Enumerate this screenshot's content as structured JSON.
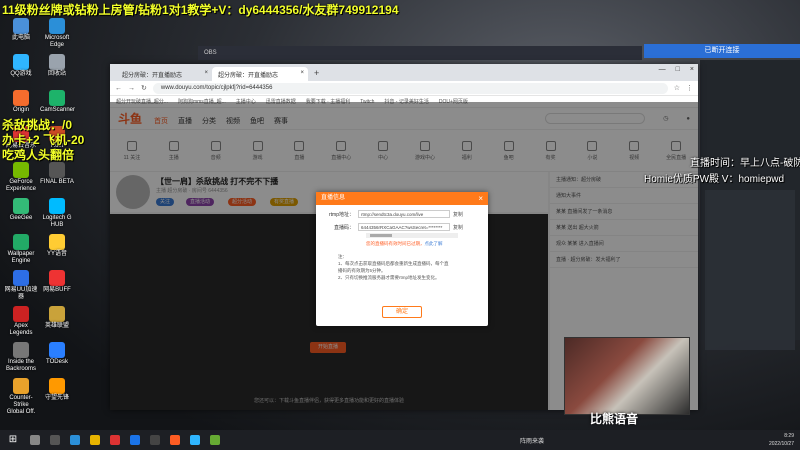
{
  "overlays": {
    "top_banner": "11级粉丝牌或钻粉上房管/钻粉1对1教学+V：dy6444356/水友群749912194",
    "left_lines": [
      "杀敌挑战：/0",
      "办卡+2    飞机-20",
      "吃鸡人头翻倍"
    ],
    "right_lines": [
      "直播时间：早上八点-破防",
      "Homie优质PW殿 V：homiepwd"
    ]
  },
  "desktop_icons": [
    {
      "label": "此电脑",
      "color": "#4a90d9"
    },
    {
      "label": "Microsoft Edge",
      "color": "#2b8fd8"
    },
    {
      "label": "QQ游戏",
      "color": "#2fb5ff"
    },
    {
      "label": "回收站",
      "color": "#9aa3ad"
    },
    {
      "label": "Origin",
      "color": "#f56c2d"
    },
    {
      "label": "CamScanner",
      "color": "#1db36a"
    },
    {
      "label": "网易云音乐",
      "color": "#d33"
    },
    {
      "label": "Rust",
      "color": "#cc4b25"
    },
    {
      "label": "GeForce Experience",
      "color": "#76b900"
    },
    {
      "label": "FINAL BETA",
      "color": "#555"
    },
    {
      "label": "GeeGee",
      "color": "#3b7"
    },
    {
      "label": "Logitech G HUB",
      "color": "#0bf"
    },
    {
      "label": "Wallpaper Engine",
      "color": "#2a6"
    },
    {
      "label": "YY语音",
      "color": "#fc3"
    },
    {
      "label": "网易UU加速器",
      "color": "#2d6ee6"
    },
    {
      "label": "网易BUFF",
      "color": "#e33"
    },
    {
      "label": "Apex Legends",
      "color": "#c22"
    },
    {
      "label": "英雄联盟",
      "color": "#c9a23a"
    },
    {
      "label": "Inside the Backrooms",
      "color": "#777"
    },
    {
      "label": "TODesk",
      "color": "#2a7fff"
    },
    {
      "label": "Counter-Strike Global Off.",
      "color": "#e9a22b"
    },
    {
      "label": "守望先锋",
      "color": "#f90"
    }
  ],
  "obs": {
    "title": "OBS"
  },
  "browser": {
    "tabs": [
      {
        "label": "超分房破：开直播励志",
        "active": false
      },
      {
        "label": "超分房破：开直播励志",
        "active": true
      }
    ],
    "url": "www.douyu.com/topic/cjlpkfj?rid=6444356",
    "bookmarks": [
      "超分开玩破直播_超分...",
      "阿狗狗mms直播_超...",
      "主播中心",
      "迅雷直播数据",
      "我要下载 · 主播福利",
      "Twitch",
      "抖音 - 记录美好生活",
      "DOU+网页版"
    ]
  },
  "site": {
    "logo": "斗鱼",
    "nav": [
      "首页",
      "直播",
      "分类",
      "视频",
      "鱼吧",
      "赛事"
    ],
    "categories": [
      "11 关注",
      "主播",
      "音频",
      "游戏",
      "直播",
      "直播中心",
      "中心",
      "游戏中心",
      "福利",
      "鱼吧",
      "有奖",
      "小说",
      "视频",
      "全民直播"
    ],
    "room": {
      "title": "【世一肩】杀敌挑战 打不完不下播",
      "sub": "主播 超分房破 · 房间号 6444356",
      "tags": [
        "关注",
        "直播活动",
        "超分活动",
        "有奖直播"
      ]
    },
    "side_rows": [
      "主播通知：超分房破",
      "通知大事件",
      "某某 直播间发了一条消息",
      "某某 送出 超大火箭",
      "观众 某某 进入直播间",
      "直播 · 超分房破：发大福利了"
    ],
    "start_button": "开始直播",
    "player_note": "您还可以：下载斗鱼直播伴侣，获得更多直播功能和更好的直播体验"
  },
  "dialog": {
    "title": "直播信息",
    "rtmp_label": "rtmp地址：",
    "rtmp_value": "rtmp://sendtc3a.douyu.com/live",
    "code_label": "直播码：",
    "code_value": "6444356rRXCaGAAC?wsSecret=********",
    "copy": "复制",
    "warning": "您的直播码有效时间已过期，",
    "warning_link": "点此了解",
    "notes": [
      "注：",
      "1、每次点击获取直播码后都会重新生成直播码，每个直",
      "   播码的有效期为5分钟。",
      "2、只有切换推流服务器才需要rtmp地址发生变化。"
    ],
    "ok": "确定"
  },
  "app": {
    "bar_label": "已断开连接"
  },
  "brand": {
    "text": "比熊语音"
  },
  "taskbar": {
    "weather": "阵雨来袭",
    "time": "8:29",
    "date": "2022/10/27"
  },
  "colors": {
    "accent": "#ff5d23",
    "overlay_yellow": "#f2ff2a",
    "dialog_head": "#ff7a1a"
  }
}
